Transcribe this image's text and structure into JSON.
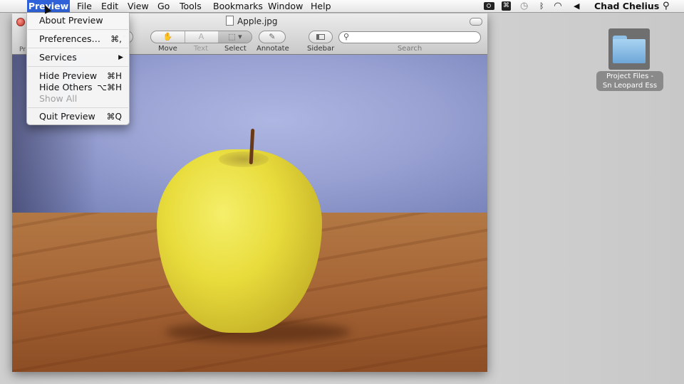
{
  "menubar": {
    "apple": "",
    "items": [
      "Preview",
      "File",
      "Edit",
      "View",
      "Go",
      "Tools",
      "Bookmarks",
      "Window",
      "Help"
    ],
    "user": "Chad Chelius",
    "tray_icons": [
      "video-camera-icon",
      "app-status-icon",
      "time-machine-icon",
      "bluetooth-icon",
      "wifi-icon",
      "volume-icon",
      "spotlight-icon"
    ]
  },
  "dropdown": {
    "about": "About Preview",
    "preferences": "Preferences…",
    "preferences_shortcut": "⌘,",
    "services": "Services",
    "hide": "Hide Preview",
    "hide_shortcut": "⌘H",
    "hide_others": "Hide Others",
    "hide_others_shortcut": "⌥⌘H",
    "show_all": "Show All",
    "quit": "Quit Preview",
    "quit_shortcut": "⌘Q"
  },
  "window": {
    "title": "Apple.jpg",
    "toolbar": {
      "move": "Move",
      "text": "Text",
      "select": "Select",
      "annotate": "Annotate",
      "sidebar": "Sidebar",
      "search": "Search",
      "partial_left": "Pr"
    }
  },
  "desktop": {
    "folder_line1": "Project Files -",
    "folder_line2": "Sn Leopard Ess"
  },
  "colors": {
    "menu_highlight": "#2f62d8",
    "close_button": "#d4352c"
  }
}
